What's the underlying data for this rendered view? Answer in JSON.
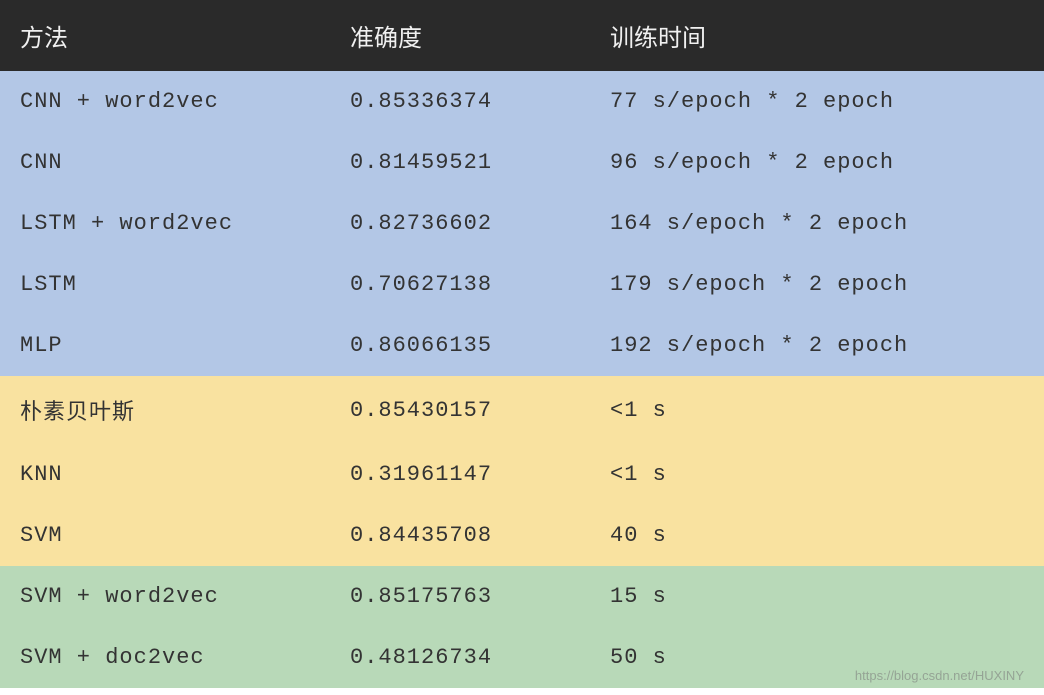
{
  "table": {
    "headers": {
      "method": "方法",
      "accuracy": "准确度",
      "time": "训练时间"
    },
    "rows": [
      {
        "method": "CNN + word2vec",
        "accuracy": "0.85336374",
        "time": "77 s/epoch * 2 epoch",
        "group": "blue"
      },
      {
        "method": "CNN",
        "accuracy": "0.81459521",
        "time": "96 s/epoch * 2 epoch",
        "group": "blue"
      },
      {
        "method": "LSTM + word2vec",
        "accuracy": "0.82736602",
        "time": "164 s/epoch * 2 epoch",
        "group": "blue"
      },
      {
        "method": "LSTM",
        "accuracy": "0.70627138",
        "time": "179 s/epoch * 2 epoch",
        "group": "blue"
      },
      {
        "method": "MLP",
        "accuracy": "0.86066135",
        "time": "192 s/epoch * 2 epoch",
        "group": "blue"
      },
      {
        "method": "朴素贝叶斯",
        "accuracy": "0.85430157",
        "time": "<1 s",
        "group": "yellow"
      },
      {
        "method": "KNN",
        "accuracy": "0.31961147",
        "time": "<1 s",
        "group": "yellow"
      },
      {
        "method": "SVM",
        "accuracy": "0.84435708",
        "time": "40 s",
        "group": "yellow"
      },
      {
        "method": "SVM + word2vec",
        "accuracy": "0.85175763",
        "time": "15 s",
        "group": "green"
      },
      {
        "method": "SVM + doc2vec",
        "accuracy": "0.48126734",
        "time": "50 s",
        "group": "green"
      }
    ]
  },
  "watermark": "https://blog.csdn.net/HUXINY",
  "colors": {
    "header_bg": "#2a2a2a",
    "header_fg": "#f0f0f0",
    "blue": "#b3c7e6",
    "yellow": "#f9e2a0",
    "green": "#b8d9b8"
  }
}
